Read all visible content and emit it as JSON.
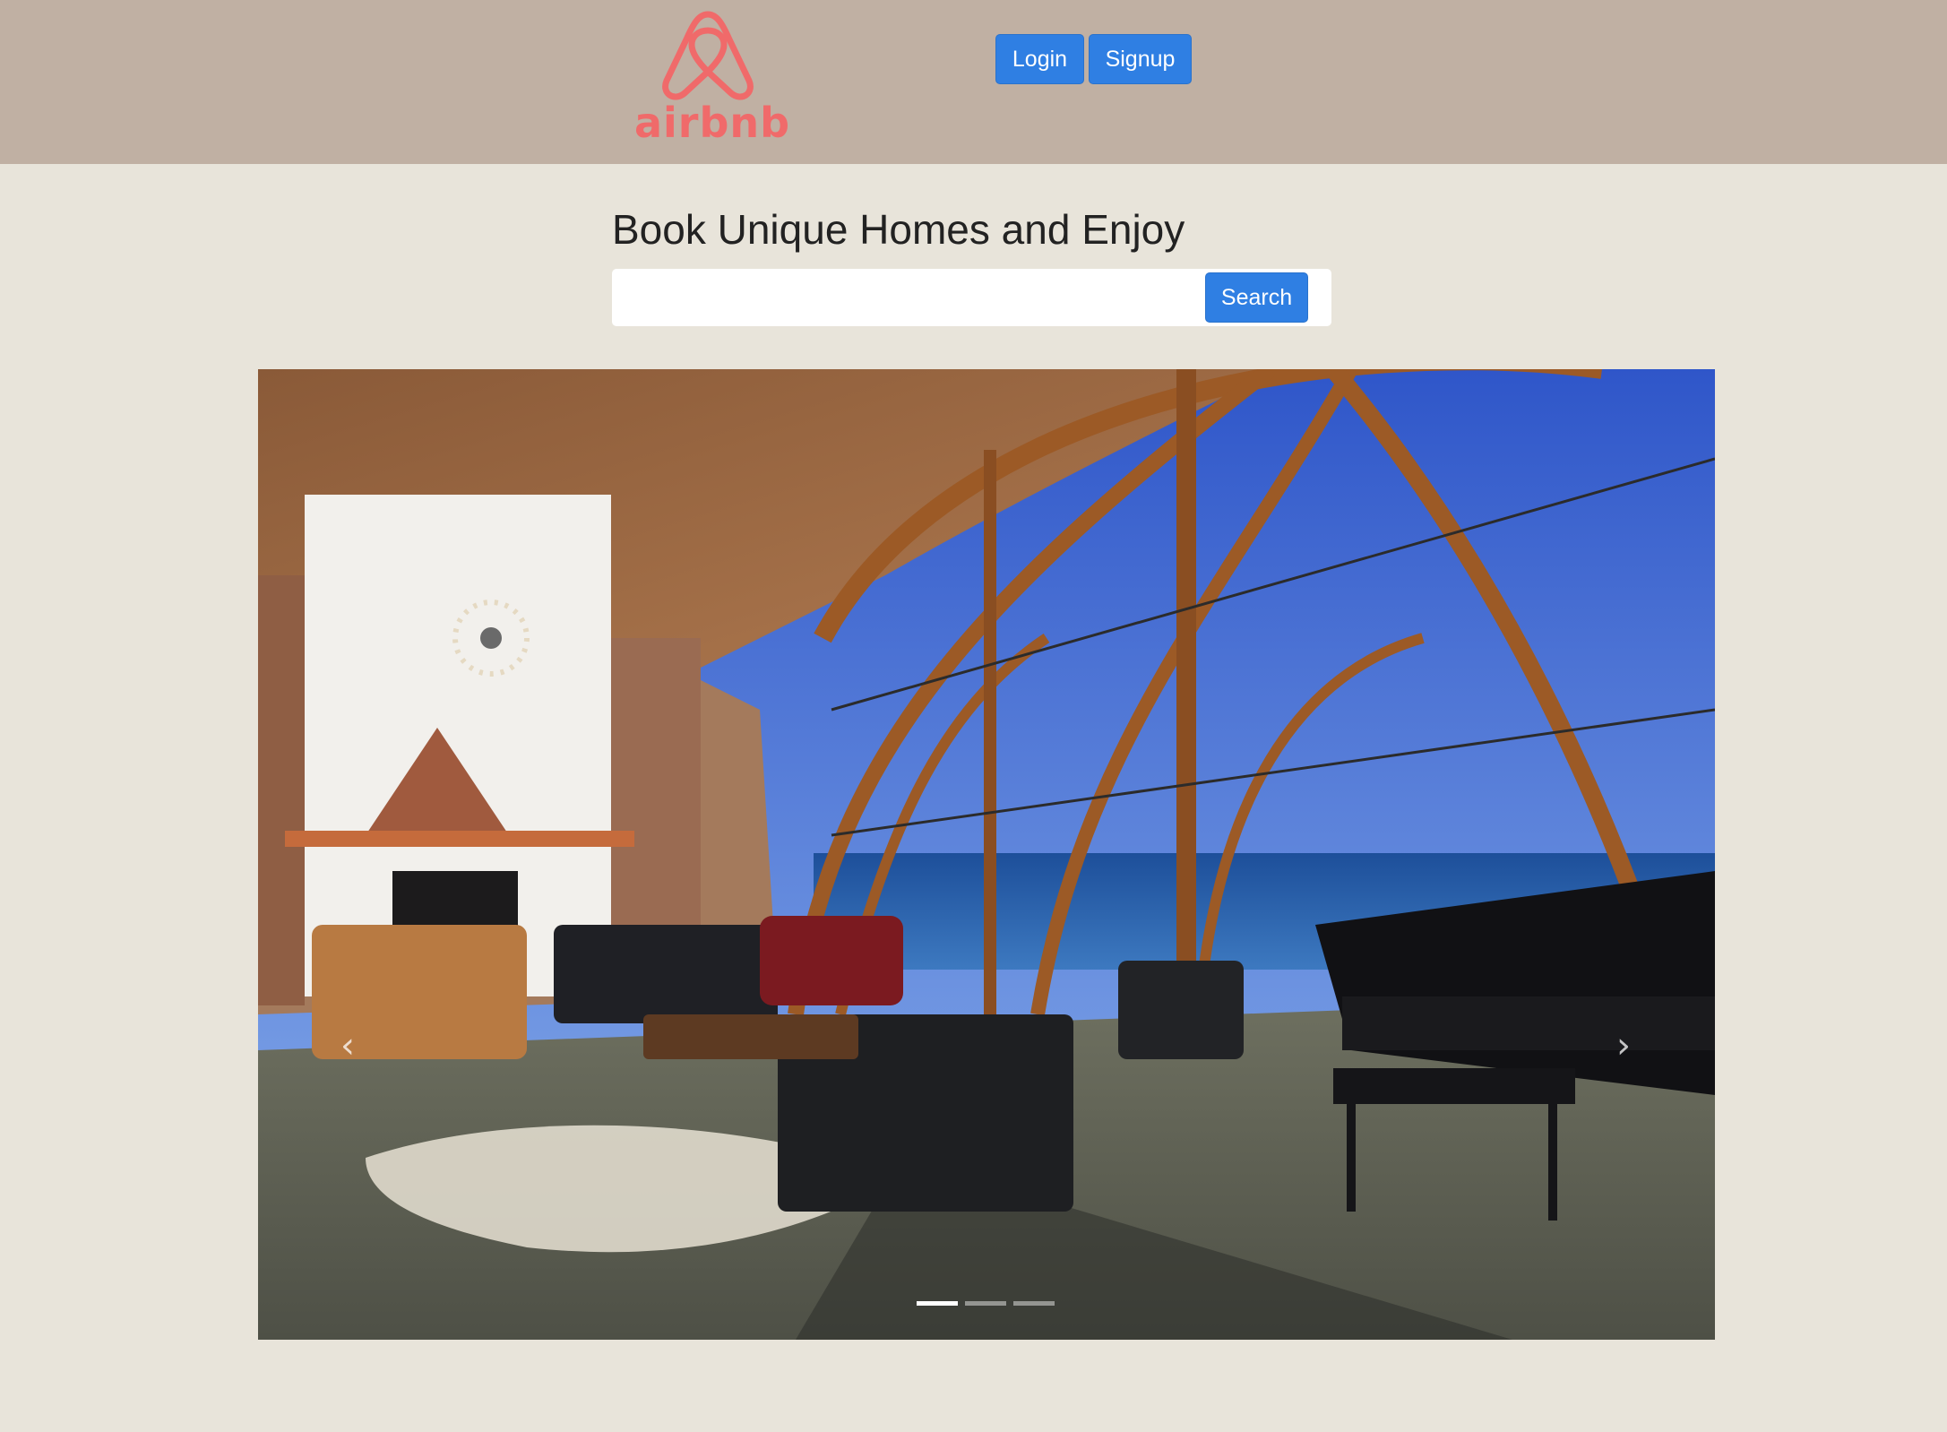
{
  "header": {
    "logo_text": "airbnb",
    "login_label": "Login",
    "signup_label": "Signup"
  },
  "hero": {
    "title": "Book Unique Homes and Enjoy",
    "search_value": "",
    "search_label": "Search"
  },
  "carousel": {
    "prev_icon": "chevron-left-icon",
    "next_icon": "chevron-right-icon",
    "slide_count": 3,
    "active_index": 0
  },
  "colors": {
    "header_bg": "#c0b0a3",
    "page_bg": "#e8e4da",
    "brand": "#f06a6a",
    "button": "#2f7fe3"
  }
}
